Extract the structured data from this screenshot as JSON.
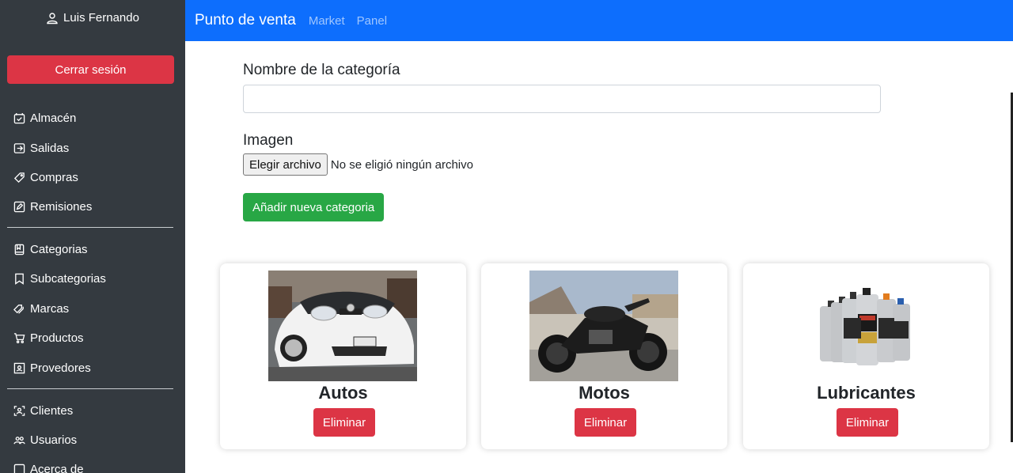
{
  "sidebar": {
    "user_name": "Luis Fernando",
    "logout_label": "Cerrar sesión",
    "group1": [
      {
        "label": "Almacén",
        "icon": "calendar-icon"
      },
      {
        "label": "Salidas",
        "icon": "exit-icon"
      },
      {
        "label": "Compras",
        "icon": "tag-icon"
      },
      {
        "label": "Remisiones",
        "icon": "edit-icon"
      }
    ],
    "group2": [
      {
        "label": "Categorias",
        "icon": "book-icon"
      },
      {
        "label": "Subcategorias",
        "icon": "bookmark-icon"
      },
      {
        "label": "Marcas",
        "icon": "tags-icon"
      },
      {
        "label": "Productos",
        "icon": "cart-icon"
      },
      {
        "label": "Provedores",
        "icon": "contact-card-icon"
      }
    ],
    "group3": [
      {
        "label": "Clientes",
        "icon": "person-frame-icon"
      },
      {
        "label": "Usuarios",
        "icon": "people-icon"
      },
      {
        "label": "Acerca de",
        "icon": "info-icon"
      }
    ]
  },
  "navbar": {
    "brand": "Punto de venta",
    "links": [
      "Market",
      "Panel"
    ]
  },
  "form": {
    "name_label": "Nombre de la categoría",
    "name_value": "",
    "image_label": "Imagen",
    "file_button": "Elegir archivo",
    "file_status": "No se eligió ningún archivo",
    "submit_label": "Añadir nueva categoria"
  },
  "categories": [
    {
      "title": "Autos",
      "delete_label": "Eliminar",
      "image": "white-car-photo"
    },
    {
      "title": "Motos",
      "delete_label": "Eliminar",
      "image": "black-motorcycle-photo"
    },
    {
      "title": "Lubricantes",
      "delete_label": "Eliminar",
      "image": "oil-bottles-photo"
    }
  ],
  "colors": {
    "sidebar_bg": "#343a40",
    "navbar_bg": "#0d6efd",
    "danger": "#dc3545",
    "success": "#28a745"
  }
}
